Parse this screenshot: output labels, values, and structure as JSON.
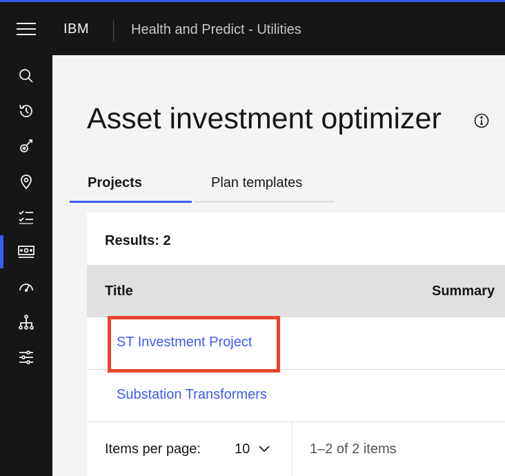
{
  "header": {
    "brand": "IBM",
    "product": "Health and Predict - Utilities"
  },
  "sidenav": {
    "items": [
      {
        "icon": "search-icon"
      },
      {
        "icon": "recent-history-icon"
      },
      {
        "icon": "asset-icon"
      },
      {
        "icon": "location-icon"
      },
      {
        "icon": "checklist-icon"
      },
      {
        "icon": "investment-icon",
        "active": true
      },
      {
        "icon": "dashboard-gauge-icon"
      },
      {
        "icon": "hierarchy-icon"
      },
      {
        "icon": "settings-sliders-icon"
      }
    ]
  },
  "page": {
    "title": "Asset investment optimizer"
  },
  "tabs": [
    {
      "label": "Projects",
      "selected": true
    },
    {
      "label": "Plan templates",
      "selected": false
    }
  ],
  "table": {
    "results_label": "Results: 2",
    "columns": [
      "Title",
      "Summary"
    ],
    "rows": [
      {
        "title": "ST Investment Project"
      },
      {
        "title": "Substation Transformers"
      }
    ]
  },
  "pagination": {
    "items_per_page_label": "Items per page:",
    "items_per_page_value": "10",
    "range_text": "1–2 of 2 items"
  },
  "colors": {
    "accent": "#3d5af1",
    "highlight": "#e8442c",
    "header_bg": "#161616"
  }
}
